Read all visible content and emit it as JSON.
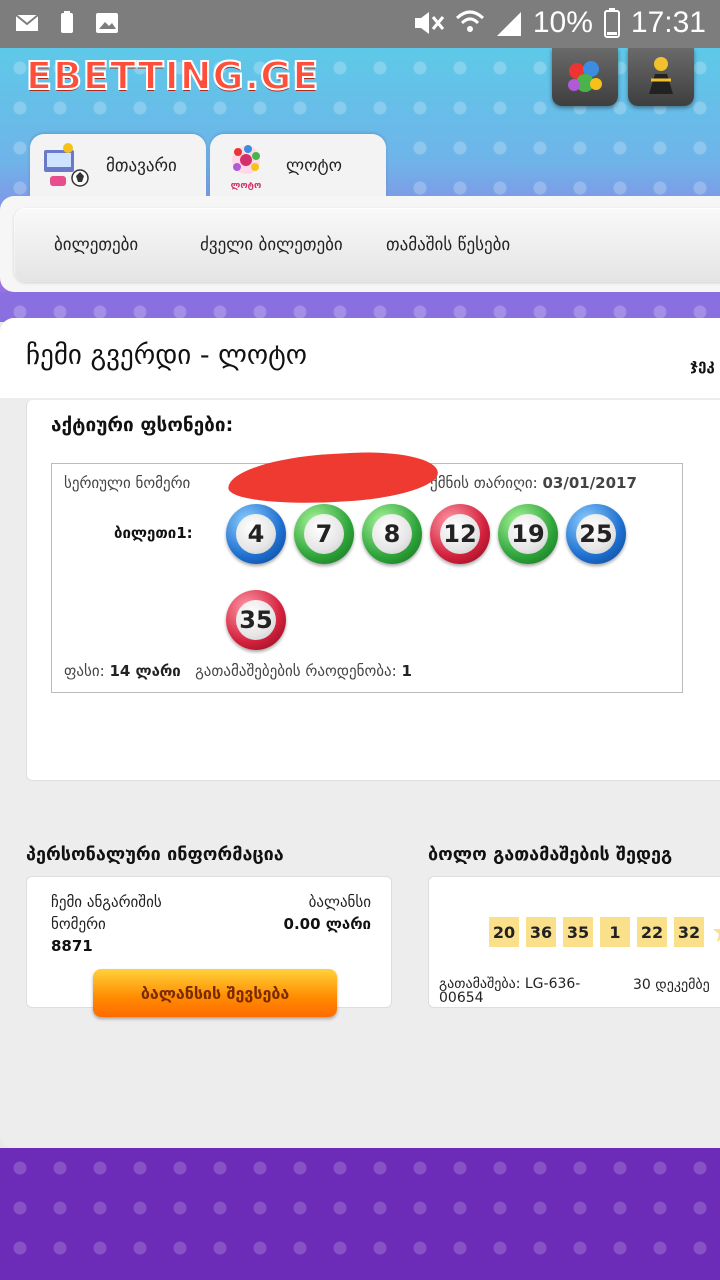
{
  "status_bar": {
    "battery": "10%",
    "time": "17:31"
  },
  "header": {
    "logo": "EBETTING.GE"
  },
  "tabs": [
    {
      "label": "მთავარი"
    },
    {
      "label": "ლოტო"
    }
  ],
  "subnav": [
    {
      "label": "ბილეთები"
    },
    {
      "label": "ძველი ბილეთები"
    },
    {
      "label": "თამაშის წესები"
    }
  ],
  "page": {
    "title": "ჩემი გვერდი - ლოტო",
    "right_text": "ჯეკ"
  },
  "active": {
    "title": "აქტიური ფსონები:",
    "serial_label": "სერიული ნომერი",
    "date_label": "ქმნის თარიღი:",
    "date_value": "03/01/2017",
    "ticket_label": "ბილეთი1:",
    "balls": [
      {
        "n": "4",
        "color": "blue"
      },
      {
        "n": "7",
        "color": "green"
      },
      {
        "n": "8",
        "color": "green"
      },
      {
        "n": "12",
        "color": "red"
      },
      {
        "n": "19",
        "color": "green"
      },
      {
        "n": "25",
        "color": "blue"
      },
      {
        "n": "35",
        "color": "red"
      }
    ],
    "price_label": "ფასი:",
    "price_value": "14 ლარი",
    "draws_label": "გათამაშებების რაოდენობა:",
    "draws_value": "1"
  },
  "personal": {
    "title": "პერსონალური ინფორმაცია",
    "account_label_1": "ჩემი ანგარიშის",
    "account_label_2": "ნომერი",
    "account_value": "8871",
    "balance_label": "ბალანსი",
    "balance_value": "0.00 ლარი",
    "topup_label": "ბალანსის შევსება"
  },
  "last_draw": {
    "title": "ბოლო გათამაშების შედეგ",
    "numbers": [
      "20",
      "36",
      "35",
      "1",
      "22",
      "32"
    ],
    "draw_label": "გათამაშება: LG-636-",
    "draw_label_2": "00654",
    "date": "30 დეკემბე"
  },
  "colors": {
    "logo": "#ff4e3a",
    "footer": "#6d2cb8",
    "topup": "#ff8a00",
    "redaction": "#ee3a31"
  }
}
